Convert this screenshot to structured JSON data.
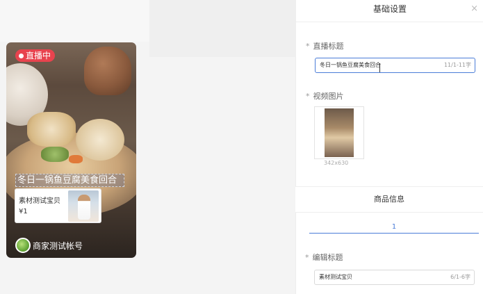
{
  "preview": {
    "live_badge": "直播中",
    "title_overlay": "冬日一锅鱼豆腐美食回合",
    "product": {
      "name": "素材测试宝贝",
      "price": "¥1"
    },
    "shop_name": "商家测试帐号"
  },
  "panel": {
    "header_title": "基础设置",
    "close_icon": "×",
    "live_title": {
      "label": "直播标题",
      "value": "冬日一锅鱼豆腐美食回合",
      "count": "11/1-11字"
    },
    "video_image": {
      "label": "视频图片",
      "size": "342x630"
    },
    "product_section": {
      "title": "商品信息",
      "tab": "1"
    },
    "edit_title": {
      "label": "编辑标题",
      "value": "素材测试宝贝",
      "count": "6/1-6字"
    }
  },
  "colors": {
    "live_red": "#e8434e",
    "accent_blue": "#4a7cd8"
  }
}
